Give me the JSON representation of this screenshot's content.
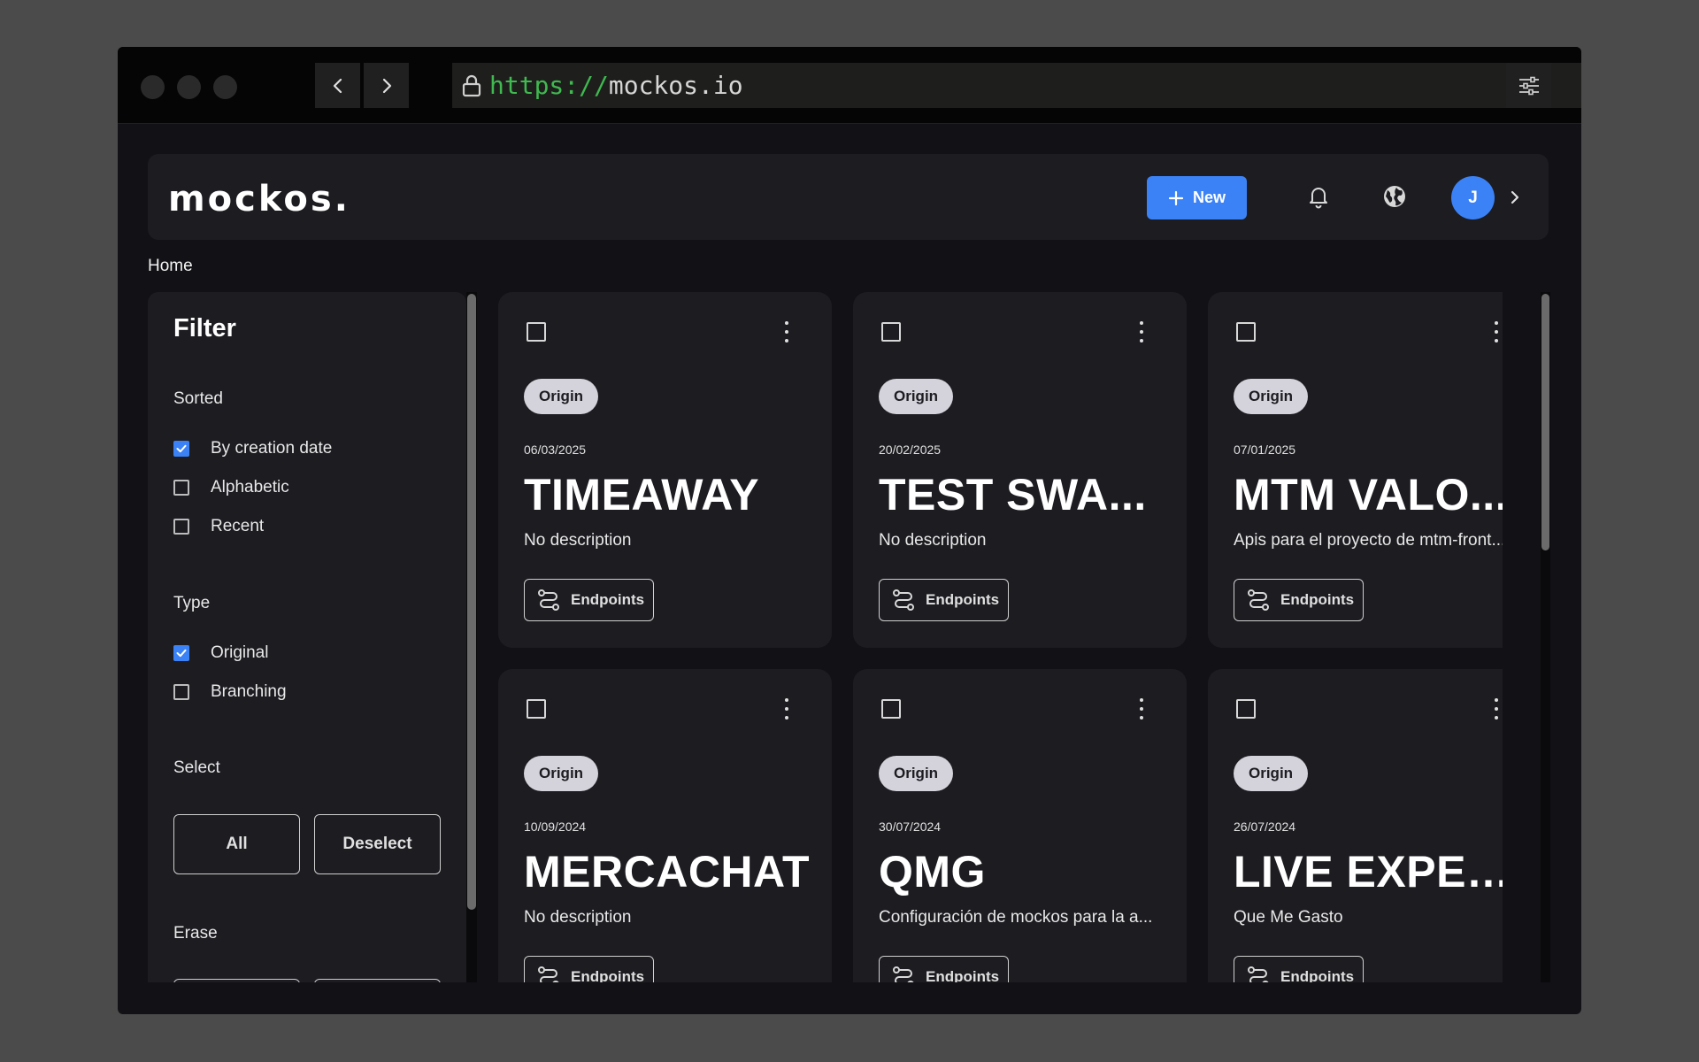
{
  "browser": {
    "url_protocol": "https://",
    "url_host": "mockos.io"
  },
  "header": {
    "logo": "mockos.",
    "new_label": "New",
    "avatar_initial": "J"
  },
  "breadcrumb": "Home",
  "filter": {
    "title": "Filter",
    "sorted": {
      "title": "Sorted",
      "options": [
        {
          "label": "By creation date",
          "checked": true
        },
        {
          "label": "Alphabetic",
          "checked": false
        },
        {
          "label": "Recent",
          "checked": false
        }
      ]
    },
    "type": {
      "title": "Type",
      "options": [
        {
          "label": "Original",
          "checked": true
        },
        {
          "label": "Branching",
          "checked": false
        }
      ]
    },
    "select": {
      "title": "Select",
      "all_label": "All",
      "deselect_label": "Deselect"
    },
    "erase": {
      "title": "Erase"
    }
  },
  "cards": [
    {
      "badge": "Origin",
      "date": "06/03/2025",
      "title": "TIMEAWAY",
      "description": "No description",
      "endpoints_label": "Endpoints"
    },
    {
      "badge": "Origin",
      "date": "20/02/2025",
      "title": "TEST SWA...",
      "description": "No description",
      "endpoints_label": "Endpoints"
    },
    {
      "badge": "Origin",
      "date": "07/01/2025",
      "title": "MTM VALO...",
      "description": "Apis para el proyecto de mtm-front...",
      "endpoints_label": "Endpoints"
    },
    {
      "badge": "Origin",
      "date": "10/09/2024",
      "title": "MERCACHAT",
      "description": "No description",
      "endpoints_label": "Endpoints"
    },
    {
      "badge": "Origin",
      "date": "30/07/2024",
      "title": "QMG",
      "description": "Configuración de mockos para la a...",
      "endpoints_label": "Endpoints"
    },
    {
      "badge": "Origin",
      "date": "26/07/2024",
      "title": "LIVE EXPEN...",
      "description": "Que Me Gasto",
      "endpoints_label": "Endpoints"
    }
  ],
  "colors": {
    "accent": "#3b82f6",
    "url_protocol": "#3fb950",
    "card_bg": "#1c1c21",
    "badge_bg": "#d4d2db"
  }
}
